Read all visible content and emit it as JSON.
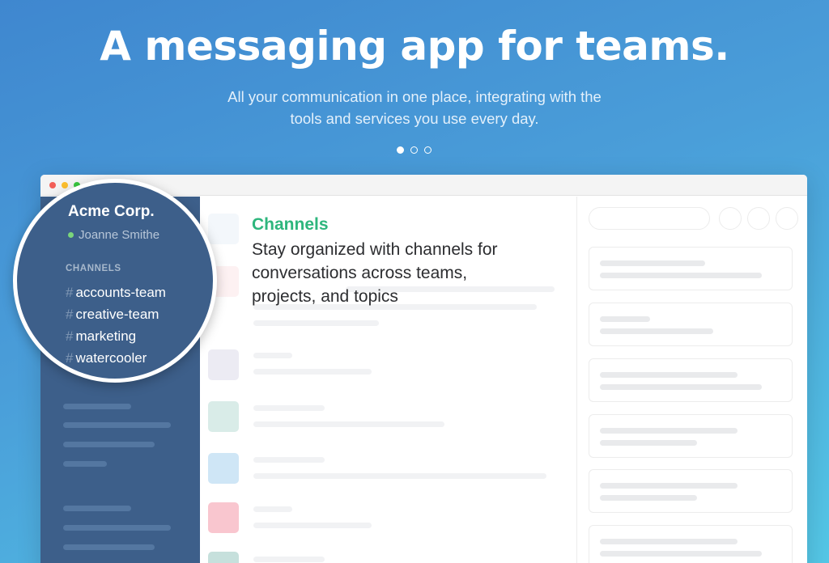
{
  "hero": {
    "title": "A messaging app for teams.",
    "subtitle_line1": "All your communication in one place, integrating with the",
    "subtitle_line2": "tools and services you use every day."
  },
  "carousel": {
    "pages": 3,
    "active": 1
  },
  "workspace": {
    "team_name": "Acme Corp.",
    "user_name": "Joanne Smithe",
    "channels_header": "CHANNELS",
    "channels": [
      {
        "hash": "#",
        "name": "accounts-team"
      },
      {
        "hash": "#",
        "name": "creative-team"
      },
      {
        "hash": "#",
        "name": "marketing"
      },
      {
        "hash": "#",
        "name": "watercooler"
      }
    ]
  },
  "feature": {
    "title": "Channels",
    "desc_line1": "Stay organized with channels for",
    "desc_line2": "conversations across teams,",
    "desc_line3": "projects, and topics"
  },
  "colors": {
    "accent_green": "#2eb67d",
    "sidebar": "#3d5f8a",
    "avatar_purple": "#ecebf3",
    "avatar_teal": "#d9ece8",
    "avatar_blue": "#cfe6f6",
    "avatar_pink": "#f9c6cf",
    "avatar_green": "#c6e0dc"
  }
}
